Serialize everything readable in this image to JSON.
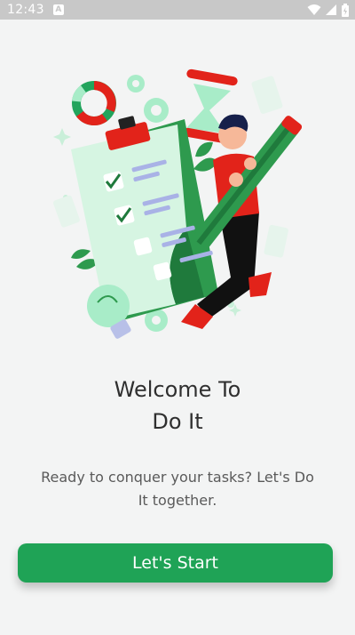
{
  "status_bar": {
    "time": "12:43",
    "notification_icon": "a-letter-icon",
    "icons": [
      "wifi-icon",
      "signal-icon",
      "battery-icon"
    ]
  },
  "illustration": {
    "description_icon": "person-checklist-pencil-illustration"
  },
  "welcome": {
    "title_line1": "Welcome To",
    "title_line2": "Do It",
    "subtitle": "Ready to conquer your tasks? Let's Do It together."
  },
  "actions": {
    "start_label": "Let's Start"
  },
  "colors": {
    "accent": "#1fa356",
    "background": "#f3f4f4",
    "status_bar": "#c8c8c8",
    "illustration_red": "#e2231a",
    "illustration_mint": "#a8ecc8"
  }
}
